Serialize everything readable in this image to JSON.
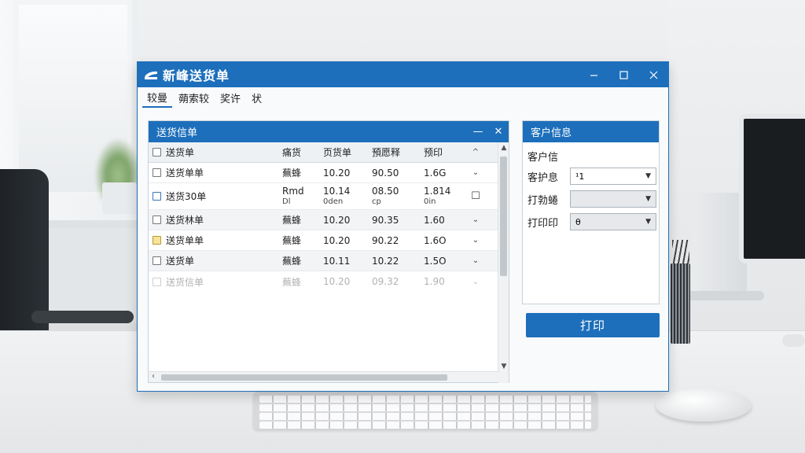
{
  "window": {
    "title": "新峰送货单"
  },
  "menu": [
    {
      "label": "较曼"
    },
    {
      "label": "蒴索较"
    },
    {
      "label": "奖许"
    },
    {
      "label": "状"
    }
  ],
  "list_panel": {
    "title": "送货信单",
    "minimize": "—",
    "close": "✕",
    "columns": [
      "送货单",
      "痛货",
      "页货单",
      "預愿释",
      "预印"
    ],
    "rows": [
      {
        "name": "送货单单",
        "a": "蕪蜂",
        "b": "10.20",
        "c": "90.50",
        "d": "1.6G",
        "act": "⌄",
        "check": "plain"
      },
      {
        "name": "送货30单",
        "a": "Rmd",
        "a2": "Dl",
        "b": "10.14",
        "b2": "0den",
        "c": "08.50",
        "c2": "cp",
        "d": "1.814",
        "d2": "0in",
        "act": "☐",
        "check": "blue"
      },
      {
        "name": "送货林单",
        "a": "蕪蜂",
        "b": "10.20",
        "c": "90.35",
        "d": "1.60",
        "act": "⌄",
        "check": "plain"
      },
      {
        "name": "送货单单",
        "a": "蕪蜂",
        "b": "10.20",
        "c": "90.22",
        "d": "1.6O",
        "act": "⌄",
        "check": "yellow"
      },
      {
        "name": "送货单",
        "a": "蕪蜂",
        "b": "10.11",
        "c": "10.22",
        "d": "1.5O",
        "act": "⌄",
        "check": "plain"
      },
      {
        "name": "送货信单",
        "a": "蕪蜂",
        "b": "10.20",
        "c": "09.32",
        "d": "1.90",
        "act": "⌄",
        "check": "plain"
      }
    ]
  },
  "customer_panel": {
    "title": "客户信息",
    "subtitle": "客户信",
    "fields": [
      {
        "label": "客护息",
        "value": "¹1"
      },
      {
        "label": "打勃蜷",
        "value": ""
      },
      {
        "label": "打印印",
        "value": "θ"
      }
    ]
  },
  "actions": {
    "print_label": "打印"
  }
}
